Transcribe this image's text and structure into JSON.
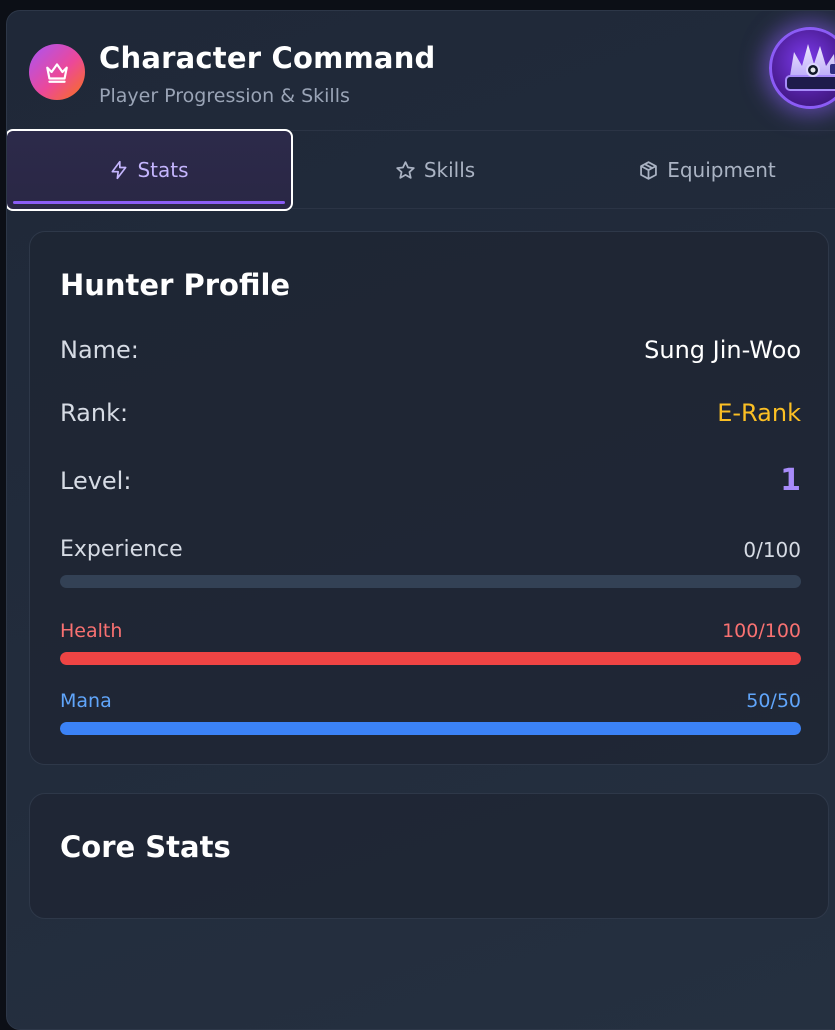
{
  "header": {
    "title": "Character Command",
    "subtitle": "Player Progression & Skills",
    "badge_icon": "crown-icon",
    "avatar_icon": "crown-emblem-icon"
  },
  "tabs": [
    {
      "label": "Stats",
      "icon": "lightning-icon",
      "active": true
    },
    {
      "label": "Skills",
      "icon": "star-icon",
      "active": false
    },
    {
      "label": "Equipment",
      "icon": "cube-icon",
      "active": false
    }
  ],
  "profile": {
    "title": "Hunter Profile",
    "name_label": "Name:",
    "name_value": "Sung Jin-Woo",
    "rank_label": "Rank:",
    "rank_value": "E-Rank",
    "level_label": "Level:",
    "level_value": "1",
    "bars": [
      {
        "label": "Experience",
        "value_text": "0/100",
        "fraction": 0,
        "label_color": "#d6dbe4",
        "fill_color": "#6366f1"
      },
      {
        "label": "Health",
        "value_text": "100/100",
        "fraction": 1,
        "label_color": "#f87171",
        "fill_color": "#ef4444"
      },
      {
        "label": "Mana",
        "value_text": "50/50",
        "fraction": 1,
        "label_color": "#60a5fa",
        "fill_color": "#3b82f6"
      }
    ]
  },
  "core": {
    "title": "Core Stats"
  },
  "colors": {
    "accent": "#8b5cf6",
    "rank": "#fbbf24",
    "level": "#a78bfa"
  }
}
